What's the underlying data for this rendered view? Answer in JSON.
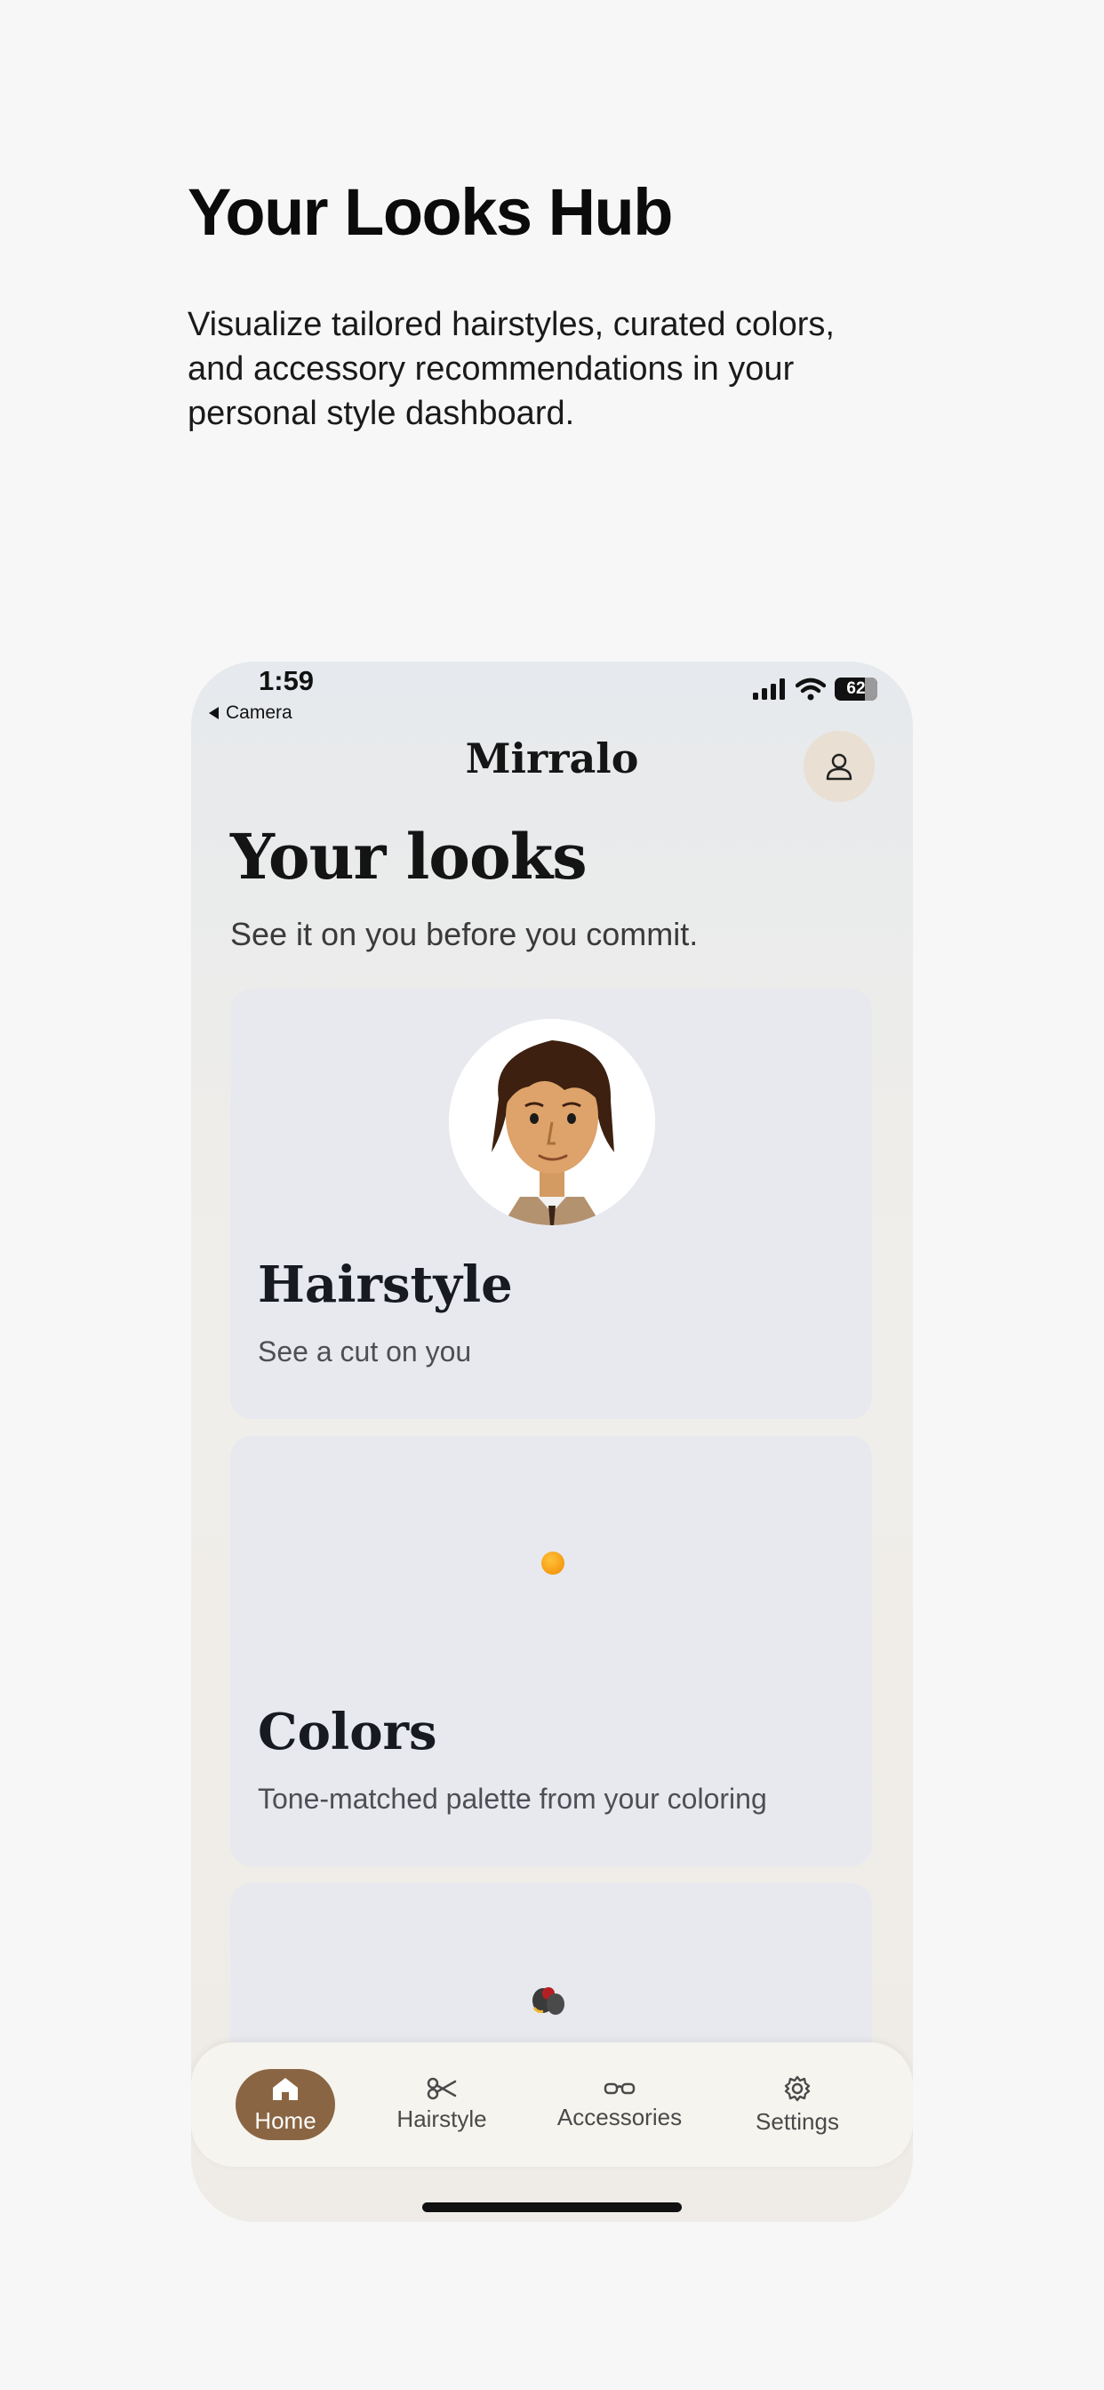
{
  "hero": {
    "title": "Your Looks Hub",
    "subtitle": "Visualize tailored hairstyles, curated colors, and accessory recommendations in your personal style dashboard."
  },
  "status_bar": {
    "time": "1:59",
    "back_label": "Camera",
    "battery": "62"
  },
  "header": {
    "brand": "Mirralo",
    "profile_icon": "person-icon"
  },
  "page": {
    "title": "Your looks",
    "subtitle": "See it on you before you commit."
  },
  "cards": [
    {
      "title": "Hairstyle",
      "subtitle": "See a cut on you",
      "icon": "avatar-illustration"
    },
    {
      "title": "Colors",
      "subtitle": "Tone-matched palette from your coloring",
      "icon": "color-dot"
    },
    {
      "icon": "accessory-illustration"
    }
  ],
  "tabbar": {
    "items": [
      {
        "label": "Home",
        "icon": "home-icon",
        "active": true
      },
      {
        "label": "Hairstyle",
        "icon": "scissors-icon",
        "active": false
      },
      {
        "label": "Accessories",
        "icon": "glasses-icon",
        "active": false
      },
      {
        "label": "Settings",
        "icon": "gear-icon",
        "active": false
      }
    ]
  },
  "colors": {
    "accent": "#8a6543",
    "card_bg": "#e7e9ee",
    "profile_bg": "#e9dfd2"
  }
}
